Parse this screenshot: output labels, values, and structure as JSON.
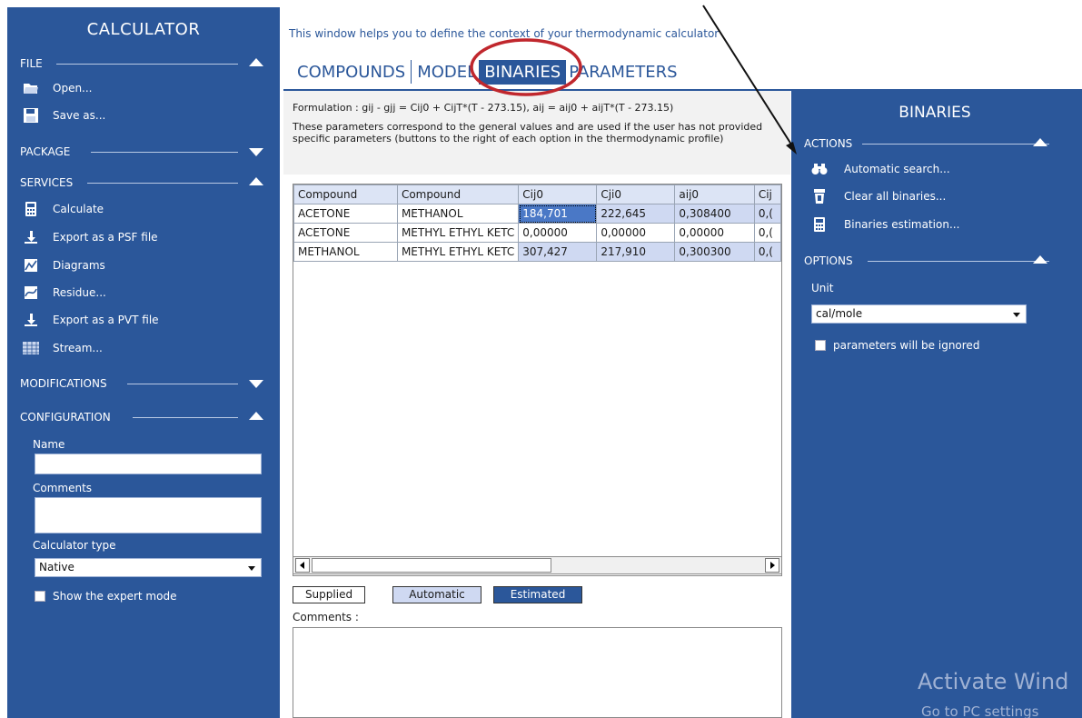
{
  "sidebar": {
    "title": "CALCULATOR",
    "sections": {
      "file": "FILE",
      "package": "PACKAGE",
      "services": "SERVICES",
      "modifications": "MODIFICATIONS",
      "configuration": "CONFIGURATION"
    },
    "file_items": [
      "Open...",
      "Save as..."
    ],
    "service_items": [
      "Calculate",
      "Export as a PSF file",
      "Diagrams",
      "Residue...",
      "Export as a PVT file",
      "Stream..."
    ],
    "config": {
      "name_label": "Name",
      "name_value": "",
      "comments_label": "Comments",
      "comments_value": "",
      "calculator_type_label": "Calculator type",
      "calculator_type_value": "Native",
      "expert_mode_label": "Show the expert mode"
    }
  },
  "main": {
    "intro": "This window helps you to define the context of your thermodynamic calculator",
    "tabs": [
      "COMPOUNDS",
      "MODEL",
      "BINARIES",
      "PARAMETERS"
    ],
    "active_tab": "BINARIES",
    "formulation": "Formulation : gij - gjj = Cij0 + CijT*(T - 273.15), aij = aij0 + aijT*(T - 273.15)",
    "note": "These parameters correspond to the general values and are used if the user has not provided specific parameters (buttons to the right of each option in the thermodynamic profile)",
    "table": {
      "columns": [
        "Compound",
        "Compound",
        "Cij0",
        "Cji0",
        "aij0",
        "Cij"
      ],
      "rows": [
        [
          "ACETONE",
          "METHANOL",
          "184,701",
          "222,645",
          "0,308400",
          "0,("
        ],
        [
          "ACETONE",
          "METHYL ETHYL KETC",
          "0,00000",
          "0,00000",
          "0,00000",
          "0,("
        ],
        [
          "METHANOL",
          "METHYL ETHYL KETC",
          "307,427",
          "217,910",
          "0,300300",
          "0,("
        ]
      ]
    },
    "legend": [
      "Supplied",
      "Automatic",
      "Estimated"
    ],
    "comments_label": "Comments :",
    "comments_value": ""
  },
  "right_panel": {
    "title": "BINARIES",
    "actions_label": "ACTIONS",
    "actions": [
      "Automatic search...",
      "Clear all binaries...",
      "Binaries estimation..."
    ],
    "options_label": "OPTIONS",
    "unit_label": "Unit",
    "unit_value": "cal/mole",
    "ignore_label": "parameters will be ignored"
  },
  "watermark": {
    "line1": "Activate Wind",
    "line2": "Go to PC settings"
  },
  "colors": {
    "panel_blue": "#2b579a",
    "header_light": "#dce4f5",
    "annotation_red": "#c0272d"
  },
  "icons": {
    "file": [
      "folder-open-icon",
      "save-icon"
    ],
    "services": [
      "calculator-icon",
      "export-icon",
      "diagram-icon",
      "residue-icon",
      "export-icon",
      "stream-icon"
    ],
    "actions": [
      "binoculars-icon",
      "eraser-icon",
      "calculator-icon"
    ]
  }
}
